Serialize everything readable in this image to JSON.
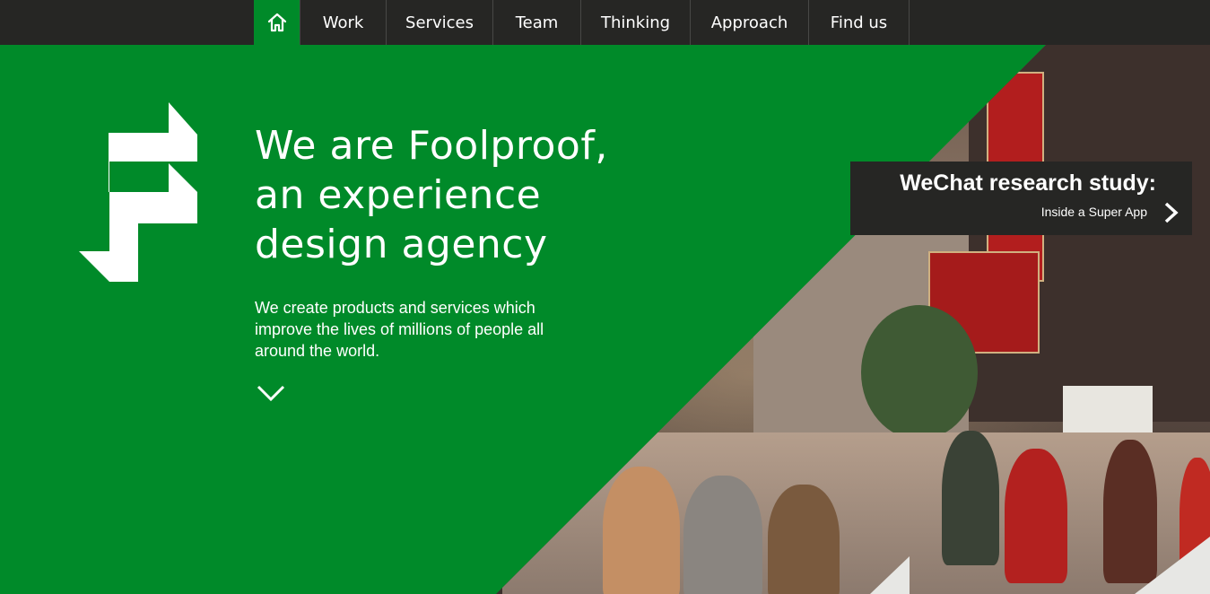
{
  "nav": {
    "home_icon": "home-icon",
    "items": [
      {
        "label": "Work"
      },
      {
        "label": "Services"
      },
      {
        "label": "Team"
      },
      {
        "label": "Thinking"
      },
      {
        "label": "Approach"
      },
      {
        "label": "Find us"
      }
    ]
  },
  "hero": {
    "headline": [
      "We are Foolproof,",
      "an experience",
      "design agency"
    ],
    "intro": "We create products and services which improve the lives of millions of people all around the world.",
    "scroll_icon": "chevron-down-icon",
    "logo_icon": "foolproof-f-logo"
  },
  "promo": {
    "title": "WeChat research study:",
    "subtitle": "Inside a Super App",
    "arrow_icon": "chevron-right-icon"
  },
  "colors": {
    "brand_green": "#008a29",
    "nav_dark": "#262624",
    "text": "#ffffff"
  }
}
